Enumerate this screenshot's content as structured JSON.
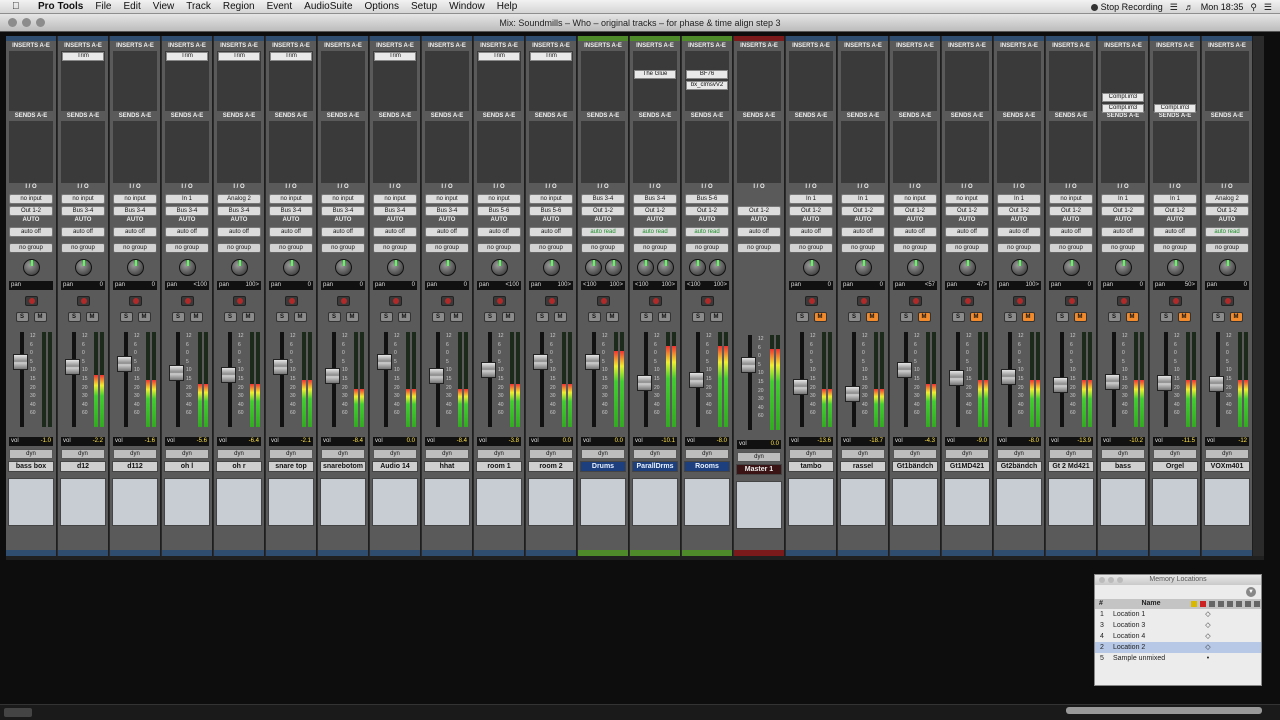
{
  "menubar": {
    "app": "Pro Tools",
    "items": [
      "File",
      "Edit",
      "View",
      "Track",
      "Region",
      "Event",
      "AudioSuite",
      "Options",
      "Setup",
      "Window",
      "Help"
    ],
    "stop_recording": "Stop Recording",
    "clock": "Mon 18:35"
  },
  "window": {
    "title": "Mix: Soundmills – Who – original tracks – for phase & time align step 3"
  },
  "labels": {
    "inserts": "INSERTS A-E",
    "sends": "SENDS A-E",
    "io": "I / O",
    "auto": "AUTO",
    "pan": "pan",
    "vol": "vol",
    "dyn": "dyn",
    "solo": "S",
    "mute": "M"
  },
  "meter_scale": [
    "12",
    "6",
    "0",
    "5",
    "10",
    "15",
    "20",
    "30",
    "40",
    "60"
  ],
  "tracks": [
    {
      "name": "bass box",
      "type": "audio",
      "inserts": [],
      "input": "no input",
      "output": "Out 1-2",
      "auto": "auto off",
      "group": "no group",
      "pan": [
        "",
        ""
      ],
      "vol": "-1.0",
      "fader": 0.72,
      "meter": 0.0,
      "solo": false,
      "mute": false
    },
    {
      "name": "d12",
      "type": "audio",
      "inserts": [
        {
          "label": "Trim",
          "slot": 0
        }
      ],
      "input": "no input",
      "output": "Bus 3-4",
      "auto": "auto off",
      "group": "no group",
      "pan": [
        "",
        "0"
      ],
      "vol": "-2.2",
      "fader": 0.66,
      "meter": 0.55,
      "solo": false,
      "mute": false
    },
    {
      "name": "d112",
      "type": "audio",
      "inserts": [],
      "input": "no input",
      "output": "Bus 3-4",
      "auto": "auto off",
      "group": "no group",
      "pan": [
        "",
        "0"
      ],
      "vol": "-1.6",
      "fader": 0.7,
      "meter": 0.5,
      "solo": false,
      "mute": false
    },
    {
      "name": "oh l",
      "type": "audio",
      "inserts": [
        {
          "label": "Trim",
          "slot": 0
        }
      ],
      "input": "In 1",
      "output": "Bus 3-4",
      "auto": "auto off",
      "group": "no group",
      "pan": [
        "",
        "<100"
      ],
      "vol": "-5.6",
      "fader": 0.58,
      "meter": 0.45,
      "solo": false,
      "mute": false
    },
    {
      "name": "oh r",
      "type": "audio",
      "inserts": [
        {
          "label": "Trim",
          "slot": 0
        }
      ],
      "input": "Analog 2",
      "output": "Bus 3-4",
      "auto": "auto off",
      "group": "no group",
      "pan": [
        "",
        "100>"
      ],
      "vol": "-6.4",
      "fader": 0.56,
      "meter": 0.45,
      "solo": false,
      "mute": false
    },
    {
      "name": "snare top",
      "type": "audio",
      "inserts": [
        {
          "label": "Trim",
          "slot": 0
        }
      ],
      "input": "no input",
      "output": "Bus 3-4",
      "auto": "auto off",
      "group": "no group",
      "pan": [
        "",
        "0"
      ],
      "vol": "-2.1",
      "fader": 0.66,
      "meter": 0.5,
      "solo": false,
      "mute": false
    },
    {
      "name": "snarebotom",
      "type": "audio",
      "inserts": [],
      "input": "no input",
      "output": "Bus 3-4",
      "auto": "auto off",
      "group": "no group",
      "pan": [
        "",
        "0"
      ],
      "vol": "-8.4",
      "fader": 0.54,
      "meter": 0.4,
      "solo": false,
      "mute": false
    },
    {
      "name": "Audio 14",
      "type": "audio",
      "inserts": [
        {
          "label": "Trim",
          "slot": 0
        }
      ],
      "input": "no input",
      "output": "Bus 3-4",
      "auto": "auto off",
      "group": "no group",
      "pan": [
        "",
        "0"
      ],
      "vol": "0.0",
      "fader": 0.72,
      "meter": 0.4,
      "solo": false,
      "mute": false
    },
    {
      "name": "hhat",
      "type": "audio",
      "inserts": [],
      "input": "no input",
      "output": "Bus 3-4",
      "auto": "auto off",
      "group": "no group",
      "pan": [
        "",
        "0"
      ],
      "vol": "-8.4",
      "fader": 0.54,
      "meter": 0.4,
      "solo": false,
      "mute": false
    },
    {
      "name": "room 1",
      "type": "audio",
      "inserts": [
        {
          "label": "Trim",
          "slot": 0
        }
      ],
      "input": "no input",
      "output": "Bus 5-6",
      "auto": "auto off",
      "group": "no group",
      "pan": [
        "",
        "<100"
      ],
      "vol": "-3.8",
      "fader": 0.62,
      "meter": 0.45,
      "solo": false,
      "mute": false
    },
    {
      "name": "room 2",
      "type": "audio",
      "inserts": [
        {
          "label": "Trim",
          "slot": 0
        }
      ],
      "input": "no input",
      "output": "Bus 5-6",
      "auto": "auto off",
      "group": "no group",
      "pan": [
        "",
        "100>"
      ],
      "vol": "0.0",
      "fader": 0.72,
      "meter": 0.45,
      "solo": false,
      "mute": false
    },
    {
      "name": "Drums",
      "type": "aux",
      "inserts": [],
      "input": "Bus 3-4",
      "output": "Out 1-2",
      "auto": "auto read",
      "group": "no group",
      "pan": [
        "<100",
        "100>"
      ],
      "vol": "0.0",
      "fader": 0.72,
      "meter": 0.8,
      "solo": false,
      "mute": false,
      "dual": true
    },
    {
      "name": "ParallDrms",
      "type": "aux",
      "inserts": [
        {
          "label": "The Glue",
          "slot": 1
        }
      ],
      "input": "Bus 3-4",
      "output": "Out 1-2",
      "auto": "auto read",
      "group": "no group",
      "pan": [
        "<100",
        "100>"
      ],
      "vol": "-10.1",
      "fader": 0.46,
      "meter": 0.85,
      "solo": false,
      "mute": false,
      "dual": true
    },
    {
      "name": "Rooms",
      "type": "aux",
      "inserts": [
        {
          "label": "BF76",
          "slot": 1
        },
        {
          "label": "bx_clmsvV2",
          "slot": 2
        }
      ],
      "input": "Bus 5-6",
      "output": "Out 1-2",
      "auto": "auto read",
      "group": "no group",
      "pan": [
        "<100",
        "100>"
      ],
      "vol": "-8.0",
      "fader": 0.5,
      "meter": 0.85,
      "solo": false,
      "mute": false,
      "dual": true
    },
    {
      "name": "Master 1",
      "type": "master",
      "inserts": [],
      "input": "",
      "output": "Out 1-2",
      "auto": "auto off",
      "group": "no group",
      "pan": [
        "",
        ""
      ],
      "vol": "0.0",
      "fader": 0.72,
      "meter": 0.85,
      "solo": false,
      "mute": false
    },
    {
      "name": "tambo",
      "type": "audio",
      "inserts": [],
      "input": "In 1",
      "output": "Out 1-2",
      "auto": "auto off",
      "group": "no group",
      "pan": [
        "",
        "0"
      ],
      "vol": "-13.6",
      "fader": 0.4,
      "meter": 0.4,
      "solo": false,
      "mute": true
    },
    {
      "name": "rassel",
      "type": "audio",
      "inserts": [],
      "input": "In 1",
      "output": "Out 1-2",
      "auto": "auto off",
      "group": "no group",
      "pan": [
        "",
        "0"
      ],
      "vol": "-18.7",
      "fader": 0.32,
      "meter": 0.4,
      "solo": false,
      "mute": true
    },
    {
      "name": "Gt1bändch",
      "type": "audio",
      "inserts": [],
      "input": "no input",
      "output": "Out 1-2",
      "auto": "auto off",
      "group": "no group",
      "pan": [
        "",
        "<57"
      ],
      "vol": "-4.3",
      "fader": 0.62,
      "meter": 0.45,
      "solo": false,
      "mute": true
    },
    {
      "name": "Gt1MD421",
      "type": "audio",
      "inserts": [],
      "input": "no input",
      "output": "Out 1-2",
      "auto": "auto off",
      "group": "no group",
      "pan": [
        "",
        "47>"
      ],
      "vol": "-9.0",
      "fader": 0.52,
      "meter": 0.5,
      "solo": false,
      "mute": true
    },
    {
      "name": "Gt2bändch",
      "type": "audio",
      "inserts": [],
      "input": "In 1",
      "output": "Out 1-2",
      "auto": "auto off",
      "group": "no group",
      "pan": [
        "",
        "100>"
      ],
      "vol": "-8.0",
      "fader": 0.53,
      "meter": 0.5,
      "solo": false,
      "mute": true
    },
    {
      "name": "Gt 2 Md421",
      "type": "audio",
      "inserts": [],
      "input": "no input",
      "output": "Out 1-2",
      "auto": "auto off",
      "group": "no group",
      "pan": [
        "",
        "0"
      ],
      "vol": "-13.9",
      "fader": 0.43,
      "meter": 0.5,
      "solo": false,
      "mute": true
    },
    {
      "name": "bass",
      "type": "audio",
      "inserts": [
        {
          "label": "Compl.im3",
          "slot": 3
        },
        {
          "label": "Compl.im3",
          "slot": 4
        }
      ],
      "input": "In 1",
      "output": "Out 1-2",
      "auto": "auto off",
      "group": "no group",
      "pan": [
        "",
        "0"
      ],
      "vol": "-10.2",
      "fader": 0.47,
      "meter": 0.5,
      "solo": false,
      "mute": true
    },
    {
      "name": "Orgel",
      "type": "audio",
      "inserts": [
        {
          "label": "Compl.im3",
          "slot": 4
        }
      ],
      "input": "In 1",
      "output": "Out 1-2",
      "auto": "auto off",
      "group": "no group",
      "pan": [
        "",
        "50>"
      ],
      "vol": "-11.5",
      "fader": 0.45,
      "meter": 0.5,
      "solo": false,
      "mute": true
    },
    {
      "name": "VOXm401",
      "type": "audio",
      "inserts": [],
      "input": "Analog 2",
      "output": "Out 1-2",
      "auto": "auto read",
      "group": "no group",
      "pan": [
        "",
        "0"
      ],
      "vol": "-12",
      "fader": 0.44,
      "meter": 0.5,
      "solo": false,
      "mute": true
    }
  ],
  "memory_locations": {
    "title": "Memory Locations",
    "col_num": "#",
    "col_name": "Name",
    "rows": [
      {
        "num": "1",
        "name": "Location 1",
        "marker": "◇",
        "selected": false
      },
      {
        "num": "3",
        "name": "Location 3",
        "marker": "◇",
        "selected": false
      },
      {
        "num": "4",
        "name": "Location 4",
        "marker": "◇",
        "selected": false
      },
      {
        "num": "2",
        "name": "Location 2",
        "marker": "◇",
        "selected": true
      },
      {
        "num": "5",
        "name": "Sample unmixed",
        "marker": "•",
        "selected": false
      }
    ]
  },
  "colors": {
    "accent_mute": "#f08a2c",
    "aux_green": "#4e8a2a",
    "master_red": "#7a1a1a",
    "audio_blue": "#2f4d6e"
  }
}
